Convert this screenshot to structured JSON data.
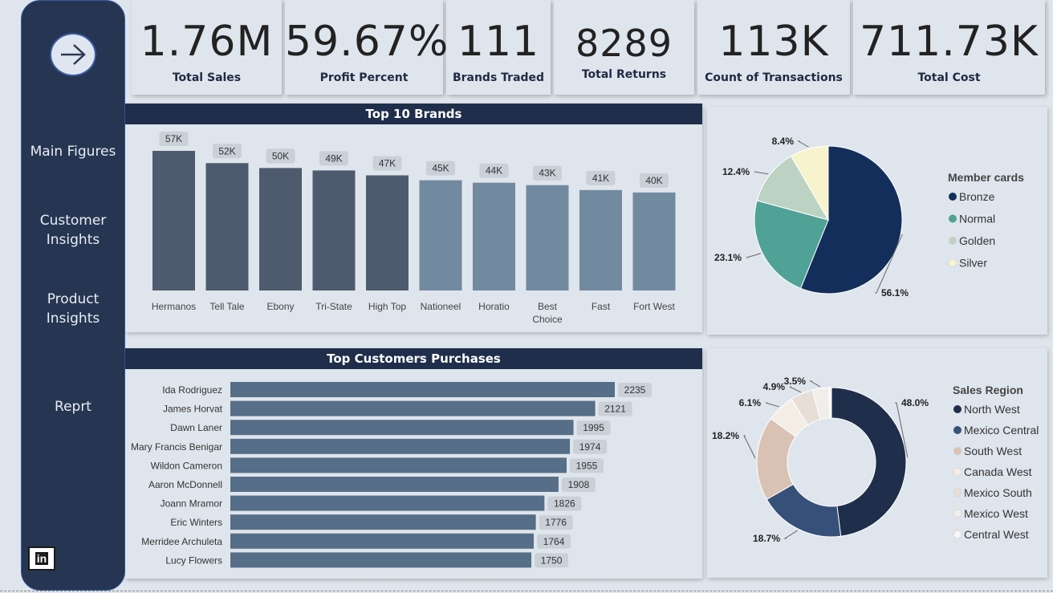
{
  "nav": {
    "items": [
      "Main Figures",
      "Customer Insights",
      "Product Insights",
      "Reprt"
    ],
    "linkedin_label": "in"
  },
  "kpis": [
    {
      "value": "1.76M",
      "label": "Total Sales"
    },
    {
      "value": "59.67%",
      "label": "Profit Percent"
    },
    {
      "value": "111",
      "label": "Brands Traded"
    },
    {
      "value": "8289",
      "label": "Total Returns"
    },
    {
      "value": "113K",
      "label": "Count of Transactions"
    },
    {
      "value": "711.73K",
      "label": "Total Cost"
    }
  ],
  "colors": {
    "dark_bar": "#4e5b6e",
    "light_bar": "#728aa0",
    "hbar": "#566e87",
    "navy": "#1f2e4a"
  },
  "chart_data": [
    {
      "type": "bar",
      "title": "Top 10 Brands",
      "categories": [
        "Hermanos",
        "Tell Tale",
        "Ebony",
        "Tri-State",
        "High Top",
        "Nationeel",
        "Horatio",
        "Best Choice",
        "Fast",
        "Fort West"
      ],
      "values": [
        57,
        52,
        50,
        49,
        47,
        45,
        44,
        43,
        41,
        40
      ],
      "value_labels": [
        "57K",
        "52K",
        "50K",
        "49K",
        "47K",
        "45K",
        "44K",
        "43K",
        "41K",
        "40K"
      ],
      "ylim": [
        0,
        57
      ]
    },
    {
      "type": "bar",
      "orientation": "horizontal",
      "title": "Top Customers Purchases",
      "categories": [
        "Ida Rodriguez",
        "James Horvat",
        "Dawn Laner",
        "Mary Francis Benigar",
        "Wildon Cameron",
        "Aaron McDonnell",
        "Joann Mramor",
        "Eric Winters",
        "Merridee Archuleta",
        "Lucy Flowers"
      ],
      "values": [
        2235,
        2121,
        1995,
        1974,
        1955,
        1908,
        1826,
        1776,
        1764,
        1750
      ],
      "xlim": [
        0,
        2235
      ]
    },
    {
      "type": "pie",
      "legend_title": "Member cards",
      "categories": [
        "Bronze",
        "Normal",
        "Golden",
        "Silver"
      ],
      "values": [
        56.1,
        23.1,
        12.4,
        8.4
      ],
      "value_labels": [
        "56.1%",
        "23.1%",
        "12.4%",
        "8.4%"
      ],
      "colors": [
        "#142e5c",
        "#4fa295",
        "#bcd2c3",
        "#f7f4cd"
      ],
      "legend": "right"
    },
    {
      "type": "pie",
      "donut": true,
      "legend_title": "Sales Region",
      "categories": [
        "North West",
        "Mexico Central",
        "South West",
        "Canada West",
        "Mexico South",
        "Mexico West",
        "Central West"
      ],
      "values": [
        48.0,
        18.7,
        18.2,
        6.1,
        4.9,
        3.5,
        0.6
      ],
      "value_labels": [
        "48.0%",
        "18.7%",
        "18.2%",
        "6.1%",
        "4.9%",
        "3.5%"
      ],
      "colors": [
        "#1f2e4a",
        "#36507a",
        "#d9c2b4",
        "#f4ede6",
        "#e6ded7",
        "#f1ede9",
        "#f7f6f4"
      ],
      "legend": "right"
    }
  ]
}
